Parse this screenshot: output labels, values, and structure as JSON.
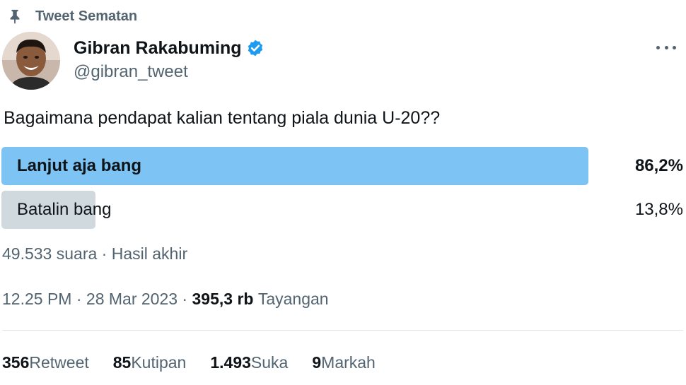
{
  "pinned": {
    "label": "Tweet Sematan"
  },
  "author": {
    "name": "Gibran Rakabuming",
    "handle": "@gibran_tweet"
  },
  "tweet": {
    "text": "Bagaimana pendapat kalian tentang piala dunia U-20??"
  },
  "poll": {
    "options": [
      {
        "label": "Lanjut aja bang",
        "percent": "86,2%",
        "fraction": 0.862
      },
      {
        "label": "Batalin bang",
        "percent": "13,8%",
        "fraction": 0.138
      }
    ],
    "votes": "49.533 suara",
    "separator": " · ",
    "status": "Hasil akhir"
  },
  "meta": {
    "time": "12.25 PM",
    "separator": " · ",
    "date": "28 Mar 2023",
    "views_count": "395,3 rb",
    "views_label": "Tayangan"
  },
  "stats": [
    {
      "count": "356",
      "label": "Retweet"
    },
    {
      "count": "85",
      "label": "Kutipan"
    },
    {
      "count": "1.493",
      "label": "Suka"
    },
    {
      "count": "9",
      "label": "Markah"
    }
  ],
  "colors": {
    "winner_bar": "#7dc3f3",
    "other_bar": "#cfd9de",
    "secondary_text": "#536471",
    "verified": "#1d9bf0"
  },
  "icons": [
    "pin-icon",
    "verified-badge-icon",
    "more-options-icon"
  ]
}
